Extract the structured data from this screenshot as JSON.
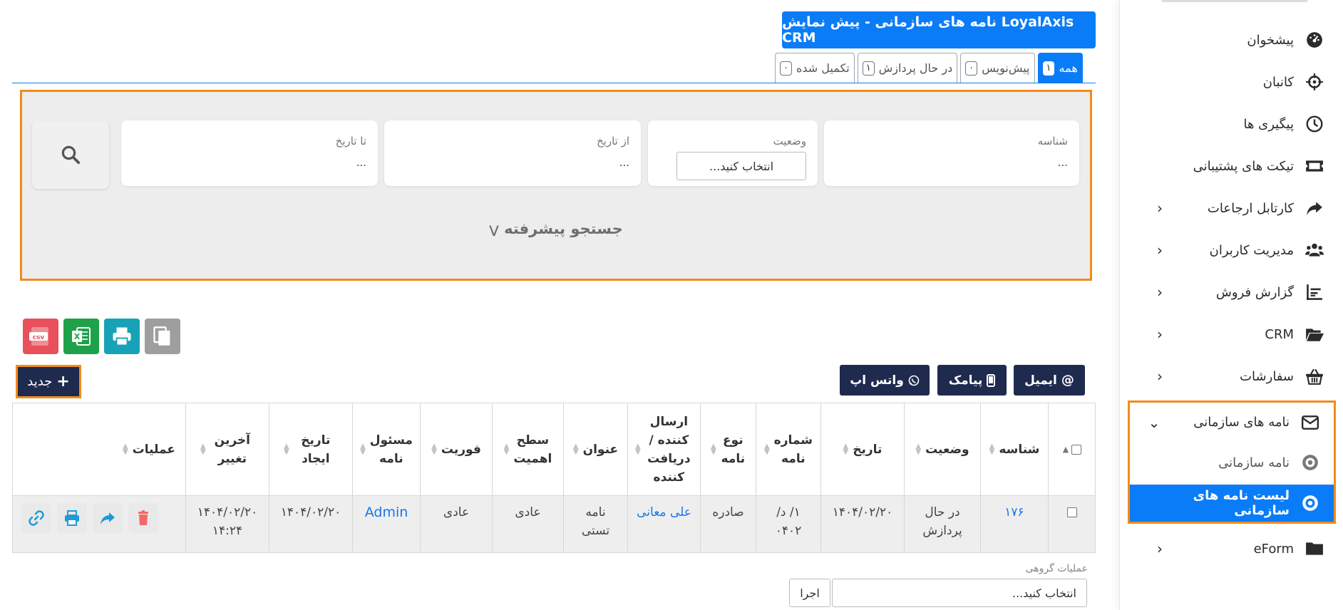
{
  "header": {
    "title": "نامه های سازمانی - پیش نمایش LoyalAxis CRM"
  },
  "tabs": [
    {
      "label": "همه",
      "count": "۱"
    },
    {
      "label": "پیش‌نویس",
      "count": "۰"
    },
    {
      "label": "در حال پردازش",
      "count": "۱"
    },
    {
      "label": "تکمیل شده",
      "count": "۰"
    }
  ],
  "filters": {
    "id_label": "شناسه",
    "id_value": "...",
    "status_label": "وضعیت",
    "status_value": "انتخاب کنید...",
    "from_label": "از تاریخ",
    "from_value": "...",
    "to_label": "تا تاریخ",
    "to_value": "...",
    "advanced_search": "جستجو پیشرفته"
  },
  "export": {
    "copy": "copy",
    "print": "print",
    "excel": "X",
    "csv": "csv"
  },
  "messaging": {
    "email": "ایمیل",
    "sms": "پیامک",
    "whatsapp": "واتس اپ"
  },
  "new_button": "جدید",
  "table": {
    "columns": [
      "شناسه",
      "وضعیت",
      "تاریخ",
      "شماره نامه",
      "نوع نامه",
      "ارسال کننده / دریافت کننده",
      "عنوان",
      "سطح اهمیت",
      "فوریت",
      "مسئول نامه",
      "تاریخ ایجاد",
      "آخرین تغییر",
      "عملیات"
    ],
    "rows": [
      {
        "id": "۱۷۶",
        "status": "در حال پردازش",
        "date": "۱۴۰۴/۰۲/۲۰",
        "number": "۱/ د/۰۴۰۲",
        "type": "صادره",
        "sender": "علی معانی",
        "title": "نامه تستی",
        "importance": "عادی",
        "urgency": "عادی",
        "owner": "Admin",
        "created": "۱۴۰۴/۰۲/۲۰",
        "modified": "۱۴۰۴/۰۲/۲۰ ۱۴:۲۴"
      }
    ]
  },
  "bulk": {
    "label": "عملیات گروهی",
    "select": "انتخاب کنید...",
    "run": "اجرا"
  },
  "sidebar": {
    "items": [
      {
        "label": "پیشخوان",
        "icon": "dashboard-icon"
      },
      {
        "label": "کانبان",
        "icon": "crosshair-icon"
      },
      {
        "label": "پیگیری ها",
        "icon": "clock-icon"
      },
      {
        "label": "تیکت های پشتیبانی",
        "icon": "ticket-icon"
      },
      {
        "label": "کارتابل ارجاعات",
        "icon": "share-icon"
      },
      {
        "label": "مدیریت کاربران",
        "icon": "users-icon"
      },
      {
        "label": "گزارش فروش",
        "icon": "chart-icon"
      },
      {
        "label": "CRM",
        "icon": "folder-open-icon"
      },
      {
        "label": "سفارشات",
        "icon": "basket-icon"
      },
      {
        "label": "نامه های سازمانی",
        "icon": "envelope-icon"
      },
      {
        "label": "نامه سازمانی",
        "icon": "circle-dot-icon"
      },
      {
        "label": "لیست نامه های سازمانی",
        "icon": "circle-dot-icon"
      },
      {
        "label": "eForm",
        "icon": "folder-icon"
      }
    ]
  },
  "colors": {
    "primary": "#0b7cf8",
    "navy": "#1f2a4f",
    "highlight": "#f28b1b",
    "excel": "#1fa14a",
    "print": "#17a2b8",
    "csv": "#e8505b",
    "copy": "#9e9e9e"
  }
}
